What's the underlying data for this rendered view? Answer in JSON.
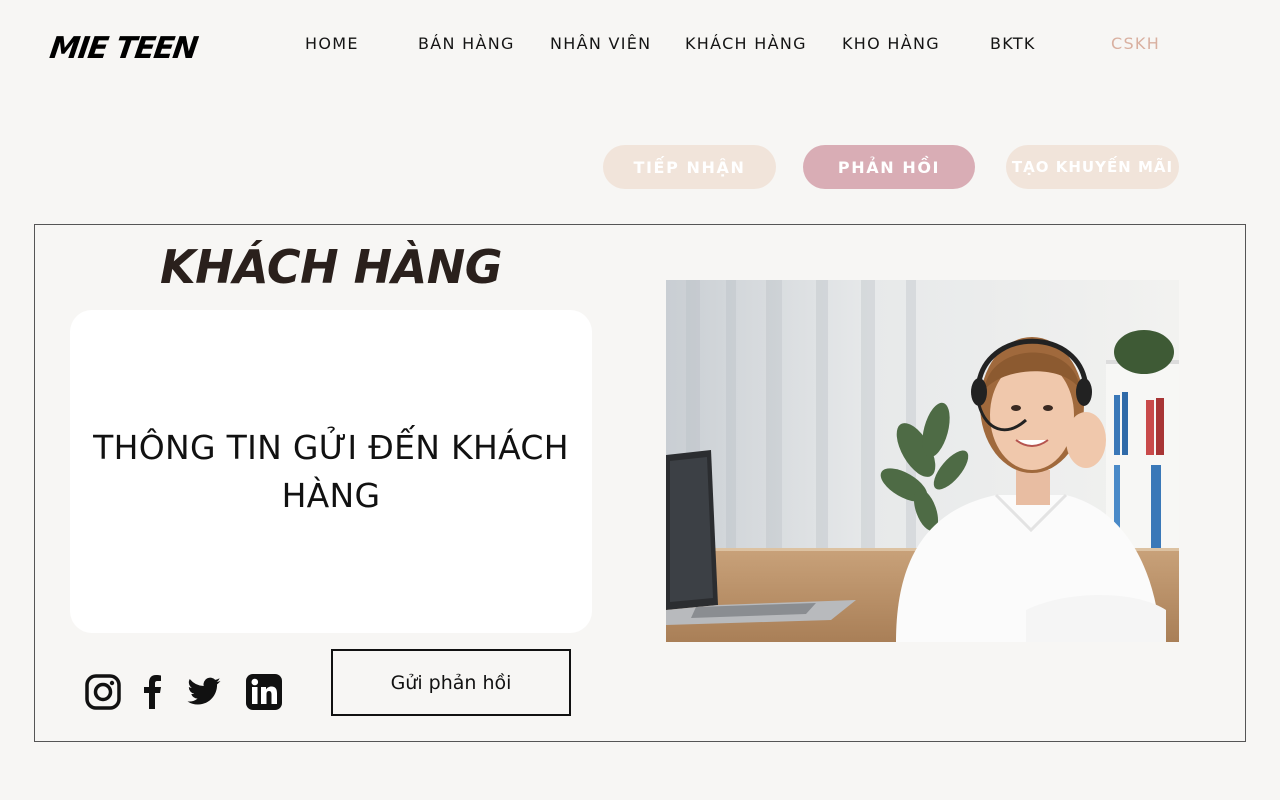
{
  "brand": {
    "logo": "MIE TEEN"
  },
  "nav": {
    "items": [
      "HOME",
      "BÁN HÀNG",
      "NHÂN VIÊN",
      "KHÁCH HÀNG",
      "KHO HÀNG",
      "BKTK",
      "CSKH"
    ],
    "active_index": 6,
    "active_color": "#d9b0a0"
  },
  "subnav": {
    "tiep_nhan": "TIẾP NHẬN",
    "phan_hoi": "PHẢN HỒI",
    "tao_khuyen_mai": "TẠO KHUYẾN MÃI",
    "colors": {
      "inactive": "#f1e4da",
      "active": "#d9adb5"
    }
  },
  "main": {
    "title": "KHÁCH HÀNG",
    "card_text": "THÔNG TIN GỬI ĐẾN KHÁCH HÀNG",
    "send_button": "Gửi phản hồi"
  },
  "socials": [
    "instagram-icon",
    "facebook-icon",
    "twitter-icon",
    "linkedin-icon"
  ]
}
